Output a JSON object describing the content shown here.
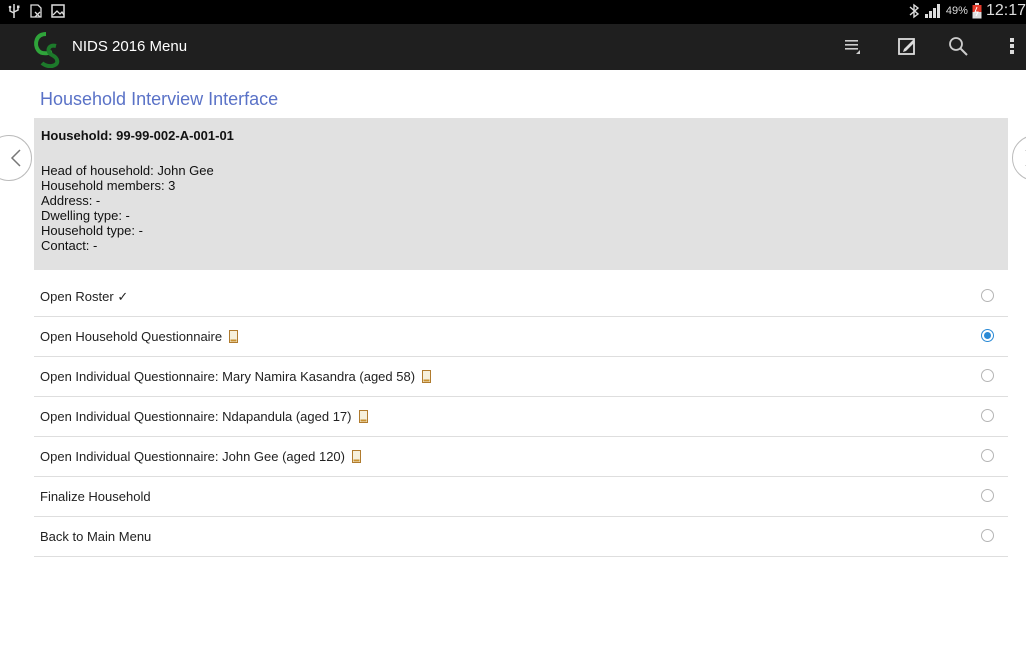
{
  "status_bar": {
    "battery": "49%",
    "time": "12:17"
  },
  "app": {
    "title": "NIDS 2016 Menu"
  },
  "page": {
    "title": "Household Interview Interface"
  },
  "household": {
    "id_line": "Household: 99-99-002-A-001-01",
    "head": "Head of household: John Gee",
    "members": "Household members: 3",
    "address": "Address: -",
    "dwelling": "Dwelling type: -",
    "type": "Household type: -",
    "contact": "Contact: -"
  },
  "menu": [
    {
      "label": "Open Roster ✓",
      "selected": false,
      "phone": false
    },
    {
      "label": "Open Household Questionnaire",
      "selected": true,
      "phone": true
    },
    {
      "label": "Open Individual Questionnaire: Mary Namira Kasandra (aged 58)",
      "selected": false,
      "phone": true
    },
    {
      "label": "Open Individual Questionnaire: Ndapandula (aged 17)",
      "selected": false,
      "phone": true
    },
    {
      "label": "Open Individual Questionnaire: John Gee (aged 120)",
      "selected": false,
      "phone": true
    },
    {
      "label": "Finalize Household",
      "selected": false,
      "phone": false
    },
    {
      "label": "Back to Main Menu",
      "selected": false,
      "phone": false
    }
  ],
  "icons": {
    "usb": "usb-icon",
    "sim": "no-sim-icon",
    "gallery": "image-icon",
    "bluetooth": "bluetooth-icon",
    "signal": "signal-icon",
    "battery": "battery-icon",
    "list": "list-icon",
    "edit": "edit-icon",
    "search": "search-icon",
    "overflow": "more-vert-icon"
  },
  "colors": {
    "accent": "#5a72c7",
    "radio_selected": "#2a8ad6",
    "info_bg": "#e1e1e1",
    "actionbar_bg": "#1f1f1f"
  }
}
